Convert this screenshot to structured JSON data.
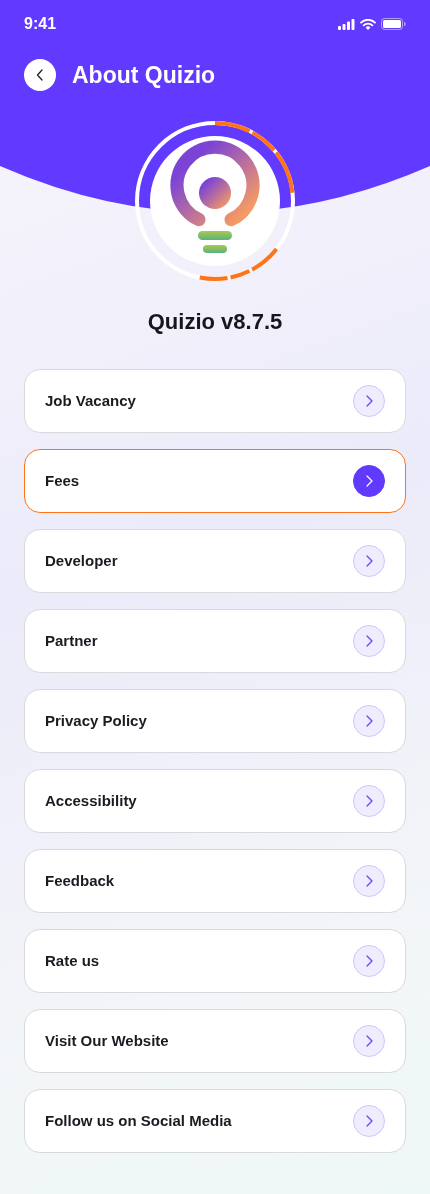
{
  "status_bar": {
    "time": "9:41"
  },
  "header": {
    "title": "About Quizio"
  },
  "app_version": "Quizio v8.7.5",
  "menu_items": [
    {
      "label": "Job Vacancy",
      "selected": false
    },
    {
      "label": "Fees",
      "selected": true
    },
    {
      "label": "Developer",
      "selected": false
    },
    {
      "label": "Partner",
      "selected": false
    },
    {
      "label": "Privacy Policy",
      "selected": false
    },
    {
      "label": "Accessibility",
      "selected": false
    },
    {
      "label": "Feedback",
      "selected": false
    },
    {
      "label": "Rate us",
      "selected": false
    },
    {
      "label": "Visit Our Website",
      "selected": false
    },
    {
      "label": "Follow us on Social Media",
      "selected": false
    }
  ]
}
